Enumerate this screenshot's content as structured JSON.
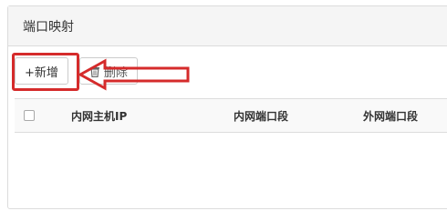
{
  "panel": {
    "title": "端口映射"
  },
  "toolbar": {
    "add_label": "+新增",
    "delete_label": "删除",
    "delete_icon": "trash-icon"
  },
  "table": {
    "columns": [
      "内网主机IP",
      "内网端口段",
      "外网端口段"
    ],
    "rows": []
  },
  "annotation": {
    "color": "#d52b2b"
  }
}
